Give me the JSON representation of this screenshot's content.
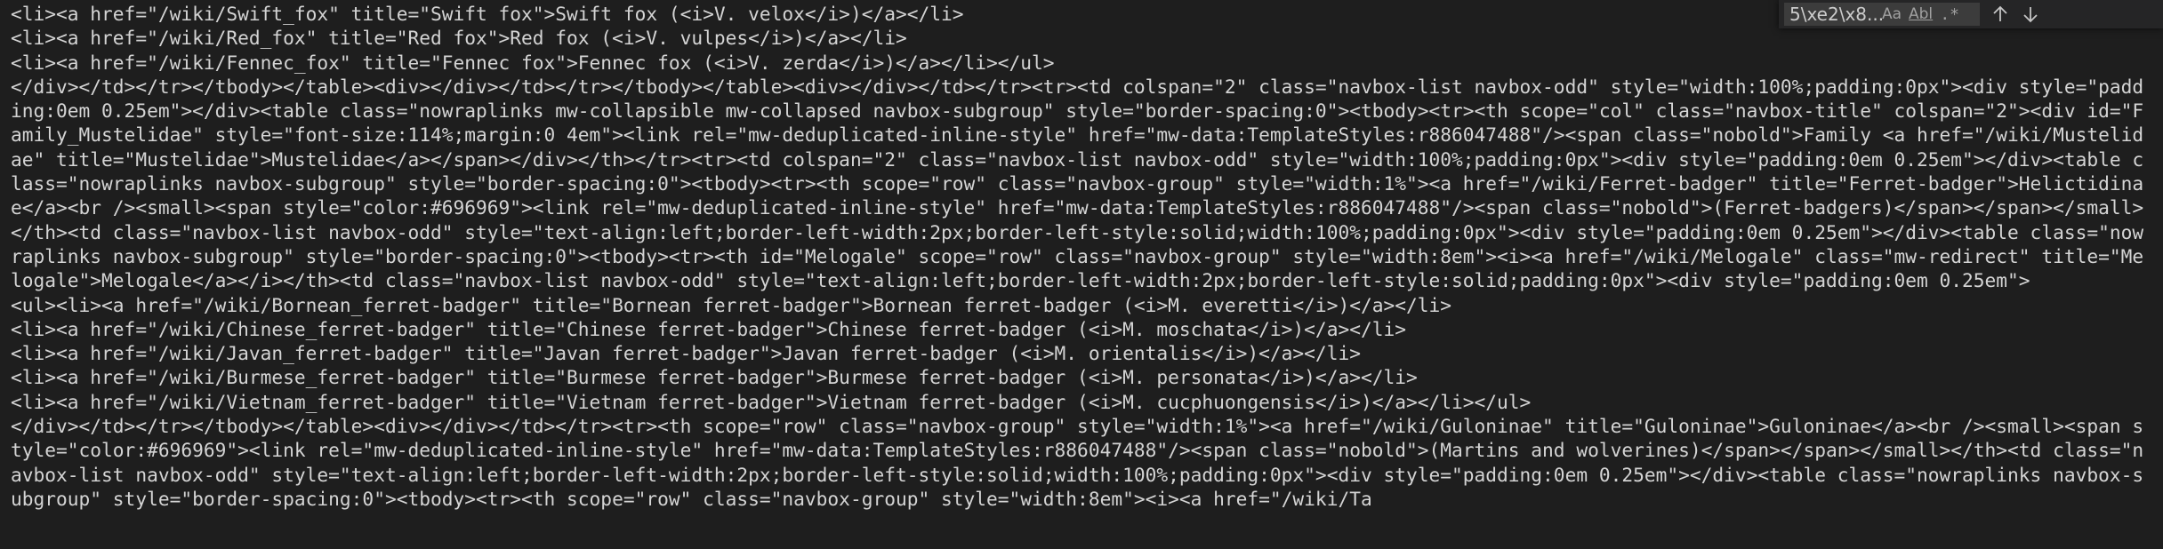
{
  "editor": {
    "lines": [
      "<li><a href=\"/wiki/Swift_fox\" title=\"Swift fox\">Swift fox (<i>V. velox</i>)</a></li>",
      "<li><a href=\"/wiki/Red_fox\" title=\"Red fox\">Red fox (<i>V. vulpes</i>)</a></li>",
      "<li><a href=\"/wiki/Fennec_fox\" title=\"Fennec fox\">Fennec fox (<i>V. zerda</i>)</a></li></ul>",
      "</div></td></tr></tbody></table><div></div></td></tr></tbody></table><div></div></td></tr><tr><td colspan=\"2\" class=\"navbox-list navbox-odd\" style=\"width:100%;padding:0px\"><div style=\"padding:0em 0.25em\"></div><table class=\"nowraplinks mw-collapsible mw-collapsed navbox-subgroup\" style=\"border-spacing:0\"><tbody><tr><th scope=\"col\" class=\"navbox-title\" colspan=\"2\"><div id=\"Family_Mustelidae\" style=\"font-size:114%;margin:0 4em\"><link rel=\"mw-deduplicated-inline-style\" href=\"mw-data:TemplateStyles:r886047488\"/><span class=\"nobold\">Family <a href=\"/wiki/Mustelidae\" title=\"Mustelidae\">Mustelidae</a></span></div></th></tr><tr><td colspan=\"2\" class=\"navbox-list navbox-odd\" style=\"width:100%;padding:0px\"><div style=\"padding:0em 0.25em\"></div><table class=\"nowraplinks navbox-subgroup\" style=\"border-spacing:0\"><tbody><tr><th scope=\"row\" class=\"navbox-group\" style=\"width:1%\"><a href=\"/wiki/Ferret-badger\" title=\"Ferret-badger\">Helictidinae</a><br /><small><span style=\"color:#696969\"><link rel=\"mw-deduplicated-inline-style\" href=\"mw-data:TemplateStyles:r886047488\"/><span class=\"nobold\">(Ferret-badgers)</span></span></small></th><td class=\"navbox-list navbox-odd\" style=\"text-align:left;border-left-width:2px;border-left-style:solid;width:100%;padding:0px\"><div style=\"padding:0em 0.25em\"></div><table class=\"nowraplinks navbox-subgroup\" style=\"border-spacing:0\"><tbody><tr><th id=\"Melogale\" scope=\"row\" class=\"navbox-group\" style=\"width:8em\"><i><a href=\"/wiki/Melogale\" class=\"mw-redirect\" title=\"Melogale\">Melogale</a></i></th><td class=\"navbox-list navbox-odd\" style=\"text-align:left;border-left-width:2px;border-left-style:solid;padding:0px\"><div style=\"padding:0em 0.25em\">",
      "<ul><li><a href=\"/wiki/Bornean_ferret-badger\" title=\"Bornean ferret-badger\">Bornean ferret-badger (<i>M. everetti</i>)</a></li>",
      "<li><a href=\"/wiki/Chinese_ferret-badger\" title=\"Chinese ferret-badger\">Chinese ferret-badger (<i>M. moschata</i>)</a></li>",
      "<li><a href=\"/wiki/Javan_ferret-badger\" title=\"Javan ferret-badger\">Javan ferret-badger (<i>M. orientalis</i>)</a></li>",
      "<li><a href=\"/wiki/Burmese_ferret-badger\" title=\"Burmese ferret-badger\">Burmese ferret-badger (<i>M. personata</i>)</a></li>",
      "<li><a href=\"/wiki/Vietnam_ferret-badger\" title=\"Vietnam ferret-badger\">Vietnam ferret-badger (<i>M. cucphuongensis</i>)</a></li></ul>",
      "</div></td></tr></tbody></table><div></div></td></tr><tr><th scope=\"row\" class=\"navbox-group\" style=\"width:1%\"><a href=\"/wiki/Guloninae\" title=\"Guloninae\">Guloninae</a><br /><small><span style=\"color:#696969\"><link rel=\"mw-deduplicated-inline-style\" href=\"mw-data:TemplateStyles:r886047488\"/><span class=\"nobold\">(Martins and wolverines)</span></span></small></th><td class=\"navbox-list navbox-odd\" style=\"text-align:left;border-left-width:2px;border-left-style:solid;width:100%;padding:0px\"><div style=\"padding:0em 0.25em\"></div><table class=\"nowraplinks navbox-subgroup\" style=\"border-spacing:0\"><tbody><tr><th scope=\"row\" class=\"navbox-group\" style=\"width:8em\"><i><a href=\"/wiki/Ta"
    ]
  },
  "find_widget": {
    "search_value": "5\\xe2\\x8...",
    "match_case_label": "Aa",
    "whole_word_label": "Abl",
    "regex_label": ".*",
    "prev_icon": "arrow-up-icon",
    "next_icon": "arrow-down-icon"
  },
  "colors": {
    "editor_background": "#1e1e1e",
    "text": "#d4d4d4",
    "find_widget_background": "#252526",
    "find_input_background": "#3c3c3c"
  }
}
